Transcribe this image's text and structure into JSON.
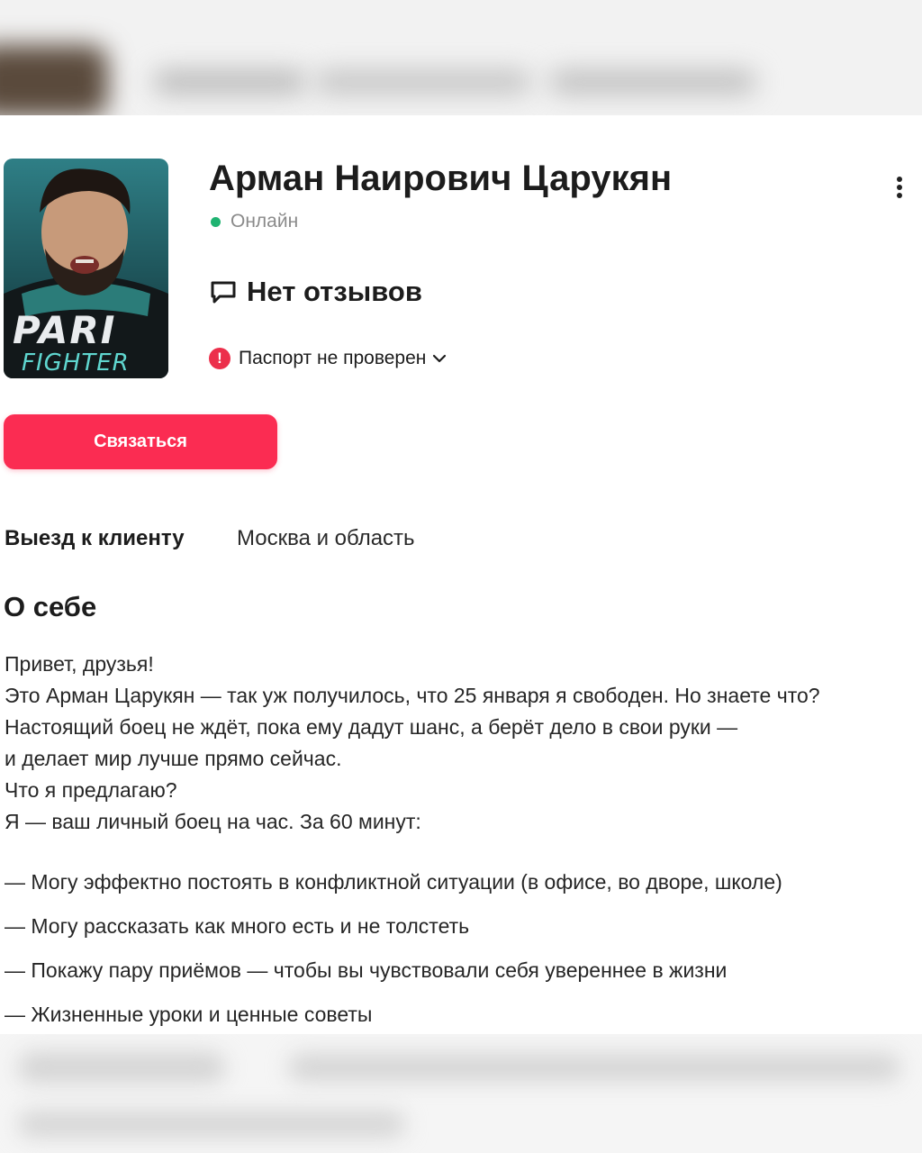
{
  "profile": {
    "name": "Арман Наирович Царукян",
    "status": "Онлайн",
    "reviews": "Нет отзывов",
    "passport": "Паспорт не проверен",
    "avatar_text_top": "PARI",
    "avatar_text_bottom": "FIGHTER"
  },
  "actions": {
    "contact": "Связаться"
  },
  "details": {
    "visit_label": "Выезд к клиенту",
    "visit_value": "Москва и область"
  },
  "about": {
    "title": "О себе",
    "lines": [
      "Привет, друзья!",
      "Это Арман Царукян — так уж получилось, что 25 января я свободен. Но знаете что?",
      "Настоящий боец не ждёт, пока ему дадут шанс, а берёт дело в свои руки —",
      "и делает мир лучше прямо сейчас.",
      "Что я предлагаю?",
      "Я — ваш личный боец на час. За 60 минут:"
    ],
    "bullets": [
      "— Могу эффектно постоять в конфликтной ситуации (в офисе, во дворе, школе)",
      "— Могу рассказать как много есть и не толстеть",
      "— Покажу пару приёмов — чтобы вы чувствовали себя увереннее в жизни",
      "— Жизненные уроки и ценные советы"
    ]
  },
  "colors": {
    "accent": "#fb2c52",
    "online": "#1fb371",
    "warning": "#ec2f4b"
  },
  "icons": [
    "more-vertical-icon",
    "speech-bubble-icon",
    "warning-icon",
    "chevron-down-icon"
  ]
}
